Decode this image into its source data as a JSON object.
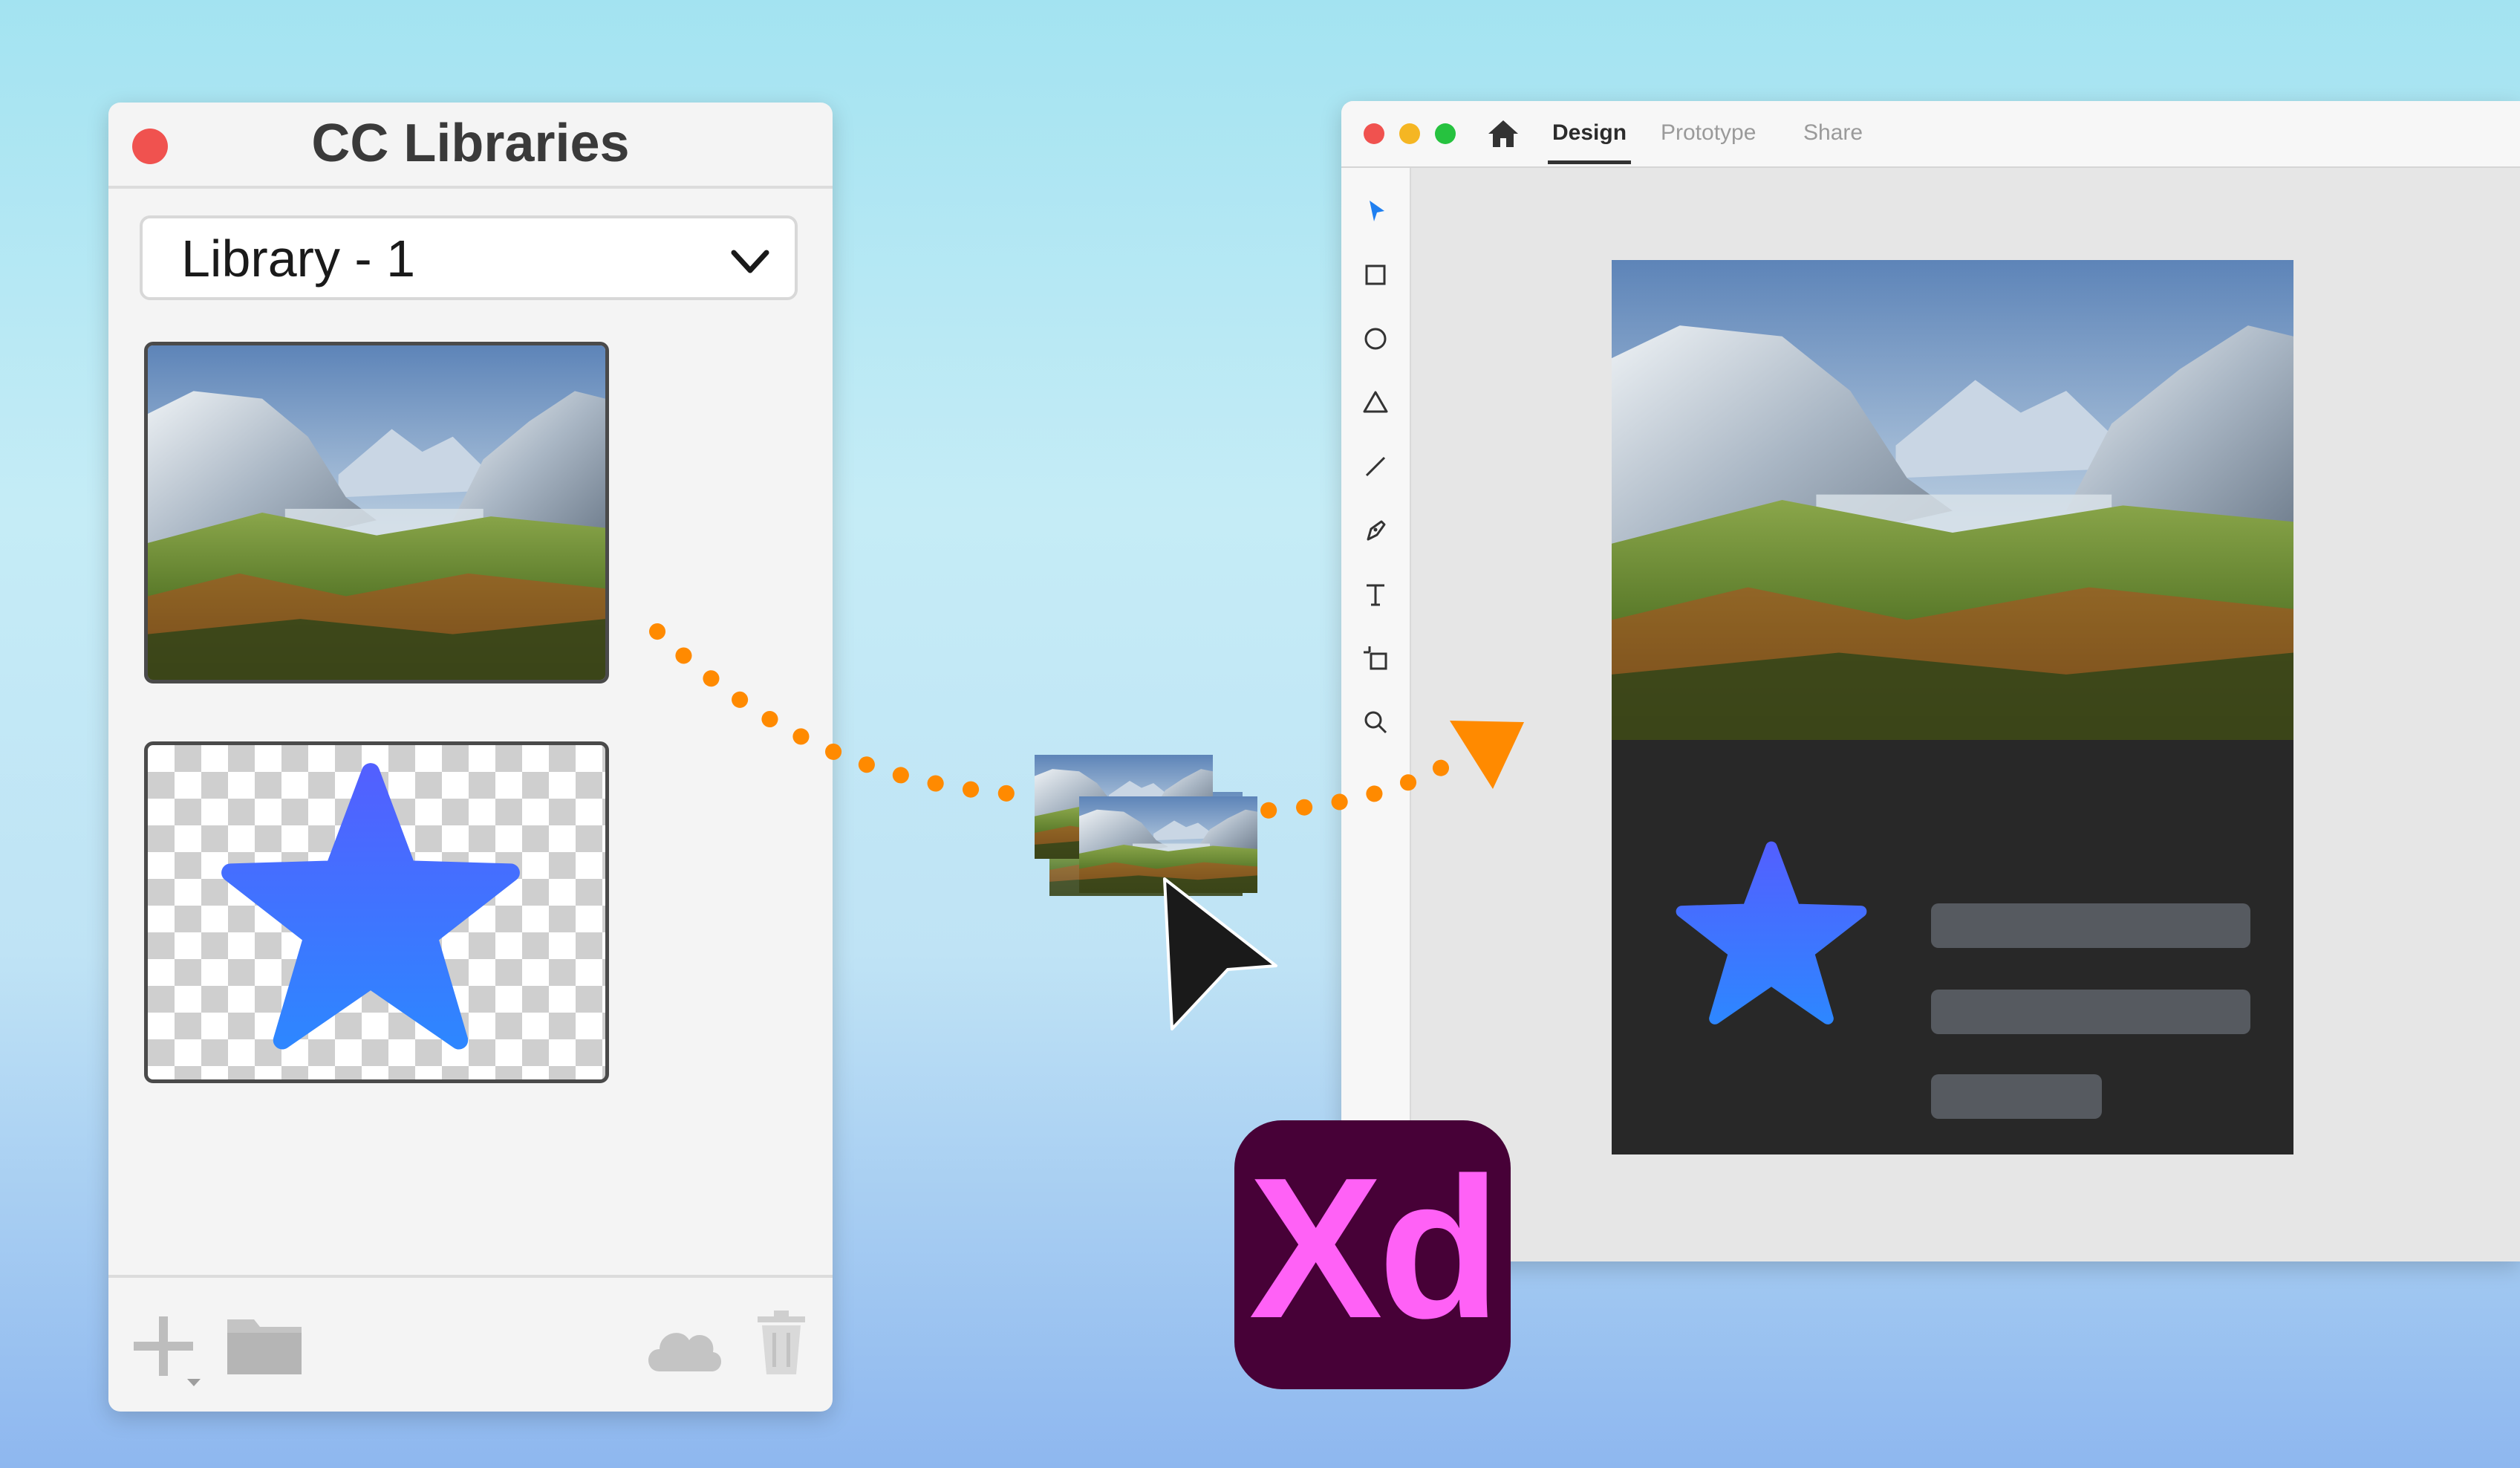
{
  "cc_libraries": {
    "title": "CC Libraries",
    "library_select": "Library - 1",
    "assets": [
      "landscape-image",
      "blue-star-graphic"
    ],
    "bottom_icons": [
      "plus-icon",
      "folder-icon",
      "cloud-icon",
      "trash-icon"
    ]
  },
  "xd_window": {
    "tabs": [
      {
        "label": "Design",
        "active": true
      },
      {
        "label": "Prototype",
        "active": false
      },
      {
        "label": "Share",
        "active": false
      }
    ],
    "tools": [
      "select-icon",
      "rectangle-icon",
      "ellipse-icon",
      "polygon-icon",
      "line-icon",
      "pen-icon",
      "text-icon",
      "artboard-icon",
      "zoom-icon"
    ]
  },
  "logo": {
    "text": "Xd"
  },
  "colors": {
    "accent_orange": "#ff8a00",
    "star_blue": "#3b72ff",
    "xd_bg": "#470137",
    "xd_text": "#ff61f6",
    "close_red": "#f0524f"
  }
}
